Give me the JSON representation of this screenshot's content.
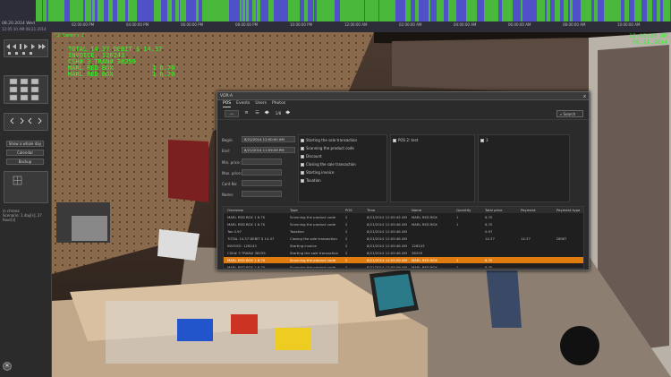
{
  "timeline": {
    "date": "08.20.2014 Wed",
    "range": "12:05:10 AM 08.21.2014",
    "ticks": [
      "02:00:00 PM",
      "04:00:00 PM",
      "06:00:00 PM",
      "08:00:00 PM",
      "10:00:00 PM",
      "12:00:00 AM",
      "02:00:00 AM",
      "04:00:00 AM",
      "06:00:00 AM",
      "08:00:00 AM",
      "10:00:00 AM"
    ],
    "colors": {
      "activity": "#4ab83a",
      "idle": "#5050c8"
    }
  },
  "left_panel": {
    "show_day_label": "Show a whole day",
    "calendar_label": "Calendar",
    "backup_label": "Backup",
    "info_lines": [
      "in chrons:",
      "Scenario: 1 day[s], 2?",
      "hour[s]"
    ],
    "close_glyph": "✕"
  },
  "video": {
    "camera_label": "C2 Camera 2",
    "osd_time": "12:05:20 AM",
    "osd_date": "08.21.2014",
    "overlay_lines": [
      [
        "TOTAL 14.37 DEBIT $ 14.37",
        ""
      ],
      [
        "INVOICE: 126243",
        ""
      ],
      [
        "CSH# 3  TRAN# 38259",
        ""
      ],
      [
        "MARL RED BOX",
        "1 6.70"
      ],
      [
        "MARL RED BOX",
        "1 6.70"
      ]
    ]
  },
  "dialog": {
    "title": "VDR-A",
    "close_glyph": "x",
    "tabs": [
      "POS",
      "Events",
      "Users",
      "Photos"
    ],
    "toolbar": {
      "page": "1/8",
      "search_label": "Search",
      "up_glyph": "︿",
      "back_glyph": "🡄",
      "fwd_glyph": "🡆"
    },
    "filters": {
      "begin_label": "Begin:",
      "begin_value": "8/21/2014 12:00:00 AM",
      "end_label": "End:",
      "end_value": "8/21/2014 11:59:59 PM",
      "min_price_label": "Min. price:",
      "max_price_label": "Max. price:",
      "card_label": "Card No:",
      "name_label": "Name:"
    },
    "events": [
      "Starting the sale transaction",
      "Scanning the product code",
      "Discount",
      "Closing the sale transaction",
      "Starting invoice",
      "Taxation"
    ],
    "pos_label": "POS 2: test",
    "user_label": "3",
    "table": {
      "headers": [
        "Overview",
        "Type",
        "POS",
        "Time",
        "Name",
        "Quantity",
        "Total price",
        "Payment",
        "Payment type"
      ],
      "rows": [
        [
          "MARL RED BOX    1 6.70",
          "Scanning the product code",
          "2",
          "8/21/2014 12:05:45 AM",
          "MARL RED BOX",
          "1",
          "6.70",
          "",
          ""
        ],
        [
          "MARL RED BOX    1 6.70",
          "Scanning the product code",
          "2",
          "8/21/2014 12:05:46 AM",
          "MARL RED BOX",
          "1",
          "6.70",
          "",
          ""
        ],
        [
          "Tax 0.97",
          "Taxation",
          "2",
          "8/21/2014 12:05:48 AM",
          "",
          "",
          "0.97",
          "",
          ""
        ],
        [
          "TOTAL 14.37 DEBIT $ 14.37",
          "Closing the sale transaction",
          "2",
          "8/21/2014 12:05:48 AM",
          "",
          "",
          "14.37",
          "14.37",
          "DEBIT"
        ],
        [
          "INVOICE: 126243",
          "Starting invoice",
          "2",
          "8/21/2014 12:05:48 AM",
          "126243",
          "",
          "",
          "",
          ""
        ],
        [
          "CSH# 3  TRAN# 38259",
          "Starting the sale transaction",
          "2",
          "8/21/2014 12:05:48 AM",
          "38259",
          "",
          "",
          "",
          ""
        ],
        [
          "MARL RED BOX    1 6.70",
          "Scanning the product code",
          "2",
          "8/21/2014 12:05:59 AM",
          "MARL RED BOX",
          "1",
          "6.70",
          "",
          ""
        ],
        [
          "MARL RED BOX    1 6.70",
          "Scanning the product code",
          "2",
          "8/21/2014 12:05:59 AM",
          "MARL RED BOX",
          "1",
          "6.70",
          "",
          ""
        ]
      ],
      "highlight_color": "#e07b10"
    }
  }
}
